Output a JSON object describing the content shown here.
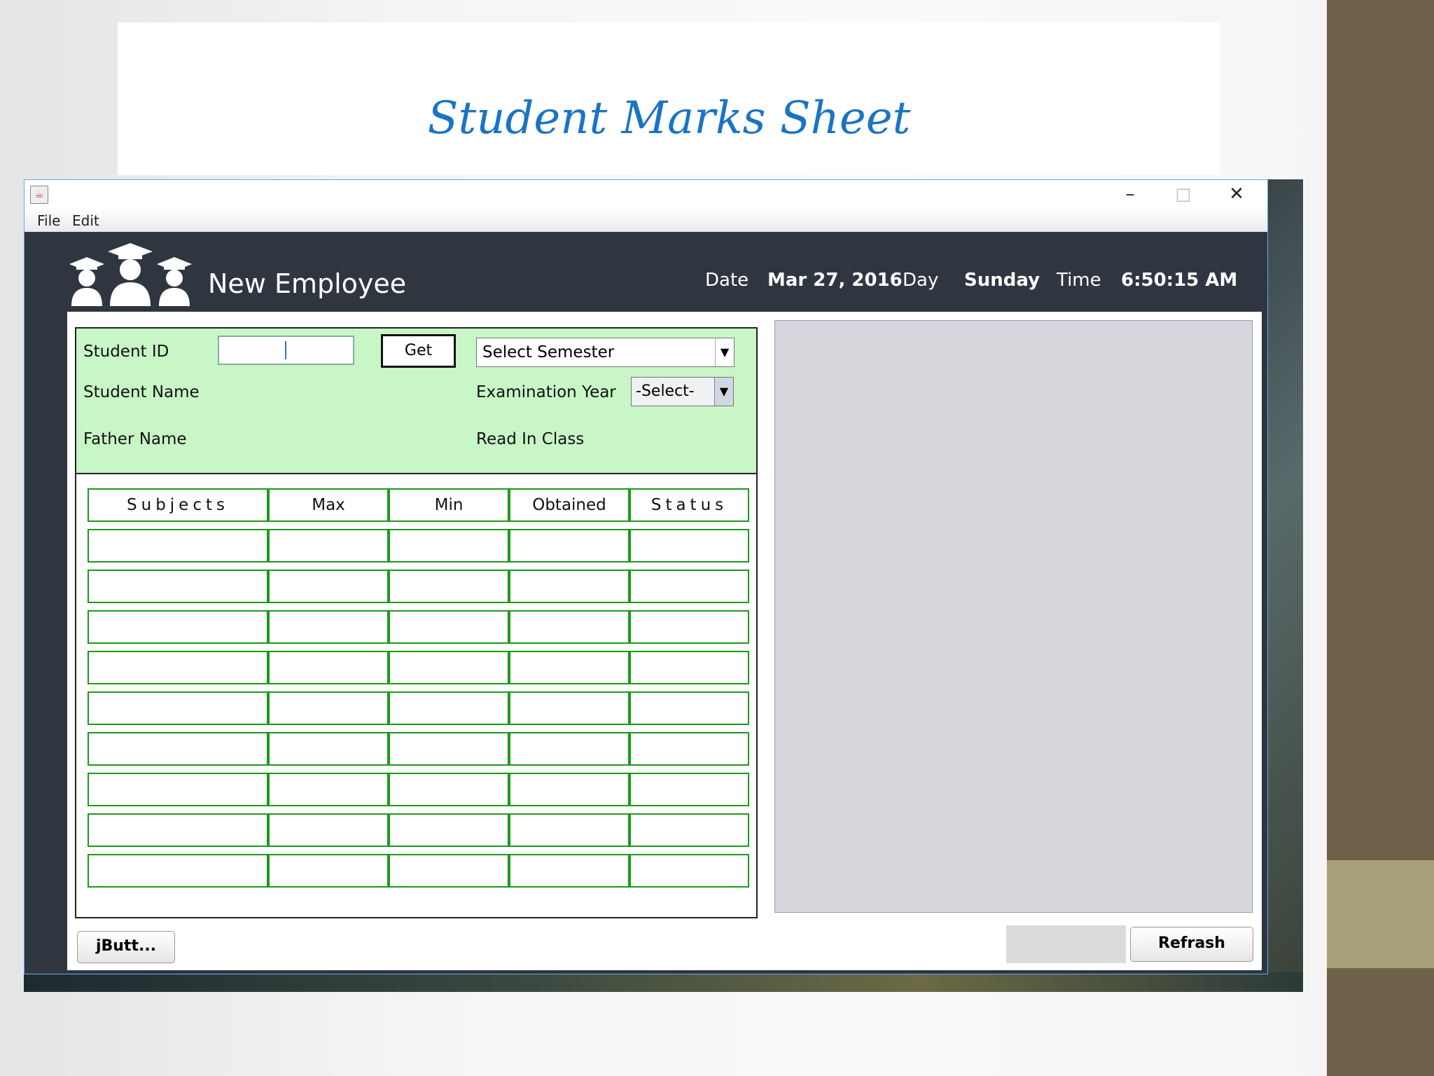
{
  "slide": {
    "title": "Student Marks Sheet"
  },
  "window": {
    "menu": [
      "File",
      "Edit"
    ],
    "controls": {
      "minimize": "–",
      "maximize": "□",
      "close": "✕"
    }
  },
  "header": {
    "title": "New Employee",
    "date_label": "Date",
    "date_value": "Mar 27, 2016",
    "day_label": "Day",
    "day_value": "Sunday",
    "time_label": "Time",
    "time_value": "6:50:15 AM",
    "logo_icon": "students-graduation-icon"
  },
  "form": {
    "student_id_label": "Student ID",
    "student_id_value": "",
    "get_label": "Get",
    "semester_selected": "Select  Semester",
    "student_name_label": "Student Name",
    "exam_year_label": "Examination Year",
    "exam_year_selected": "-Select-",
    "father_name_label": "Father Name",
    "read_in_class_label": "Read In Class"
  },
  "table": {
    "headers": [
      "Subjects",
      "Max",
      "Min",
      "Obtained",
      "Status"
    ],
    "rows": [
      [
        "",
        "",
        "",
        "",
        ""
      ],
      [
        "",
        "",
        "",
        "",
        ""
      ],
      [
        "",
        "",
        "",
        "",
        ""
      ],
      [
        "",
        "",
        "",
        "",
        ""
      ],
      [
        "",
        "",
        "",
        "",
        ""
      ],
      [
        "",
        "",
        "",
        "",
        ""
      ],
      [
        "",
        "",
        "",
        "",
        ""
      ],
      [
        "",
        "",
        "",
        "",
        ""
      ],
      [
        "",
        "",
        "",
        "",
        ""
      ]
    ]
  },
  "footer": {
    "left_button": "jButt...",
    "refresh_button": "Refrash"
  },
  "colors": {
    "form_bg": "#c8f6c7",
    "table_border": "#1b9a1b",
    "header_bg": "#2f3640",
    "title_blue": "#1a74c4"
  }
}
